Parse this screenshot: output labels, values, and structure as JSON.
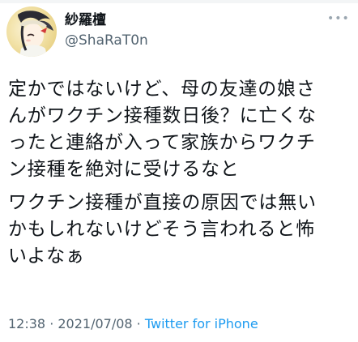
{
  "author": {
    "display_name": "紗羅檀",
    "handle": "@ShaRaT0n"
  },
  "tweet": {
    "paragraphs": [
      {
        "lines": [
          "定かではないけど、母の友達の娘さ",
          "んがワクチン接種数日後？に亡くな",
          "ったと連絡が入って家族からワクチ",
          "ン接種を絶対に受けるなと"
        ]
      },
      {
        "lines": [
          "ワクチン接種が直接の原因では無い",
          "かもしれないけどそう言われると怖",
          "いよなぁ"
        ]
      }
    ]
  },
  "meta": {
    "time": "12:38",
    "separator_1": " · ",
    "date": "2021/07/08",
    "separator_2": " · ",
    "source": "Twitter for iPhone"
  },
  "colors": {
    "text": "#0f1419",
    "secondary": "#536471",
    "link": "#1d9bf0"
  },
  "icons": {
    "avatar": "anime-avatar-icon",
    "more": "more-options-icon"
  }
}
